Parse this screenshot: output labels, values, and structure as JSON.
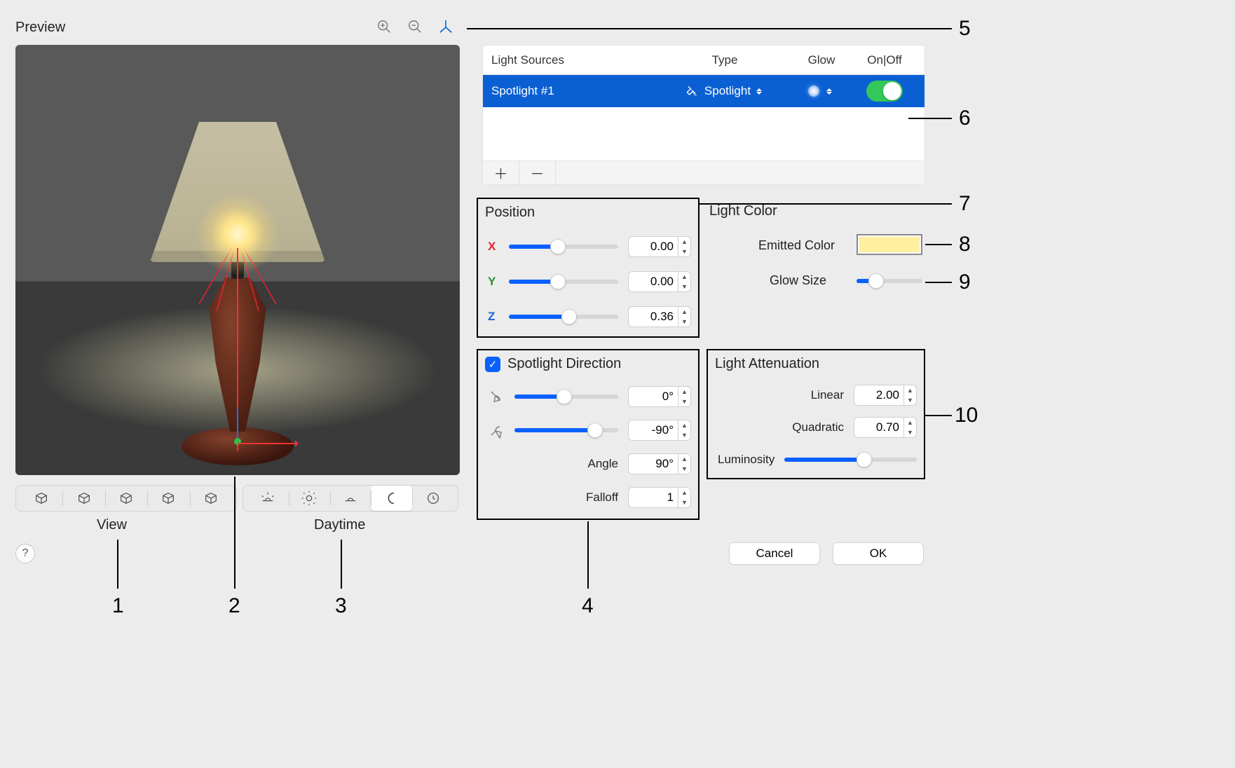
{
  "preview": {
    "title": "Preview"
  },
  "toolbar": {
    "view_label": "View",
    "daytime_label": "Daytime"
  },
  "light_table": {
    "headers": {
      "sources": "Light Sources",
      "type": "Type",
      "glow": "Glow",
      "onoff": "On|Off"
    },
    "rows": [
      {
        "name": "Spotlight #1",
        "type": "Spotlight",
        "glow_icon": "glow-dot",
        "on": true
      }
    ]
  },
  "position": {
    "title": "Position",
    "x": {
      "label": "X",
      "value": "0.00",
      "pct": 45
    },
    "y": {
      "label": "Y",
      "value": "0.00",
      "pct": 45
    },
    "z": {
      "label": "Z",
      "value": "0.36",
      "pct": 55
    }
  },
  "light_color": {
    "title": "Light Color",
    "emitted_label": "Emitted Color",
    "emitted_hex": "#ffef9e",
    "glow_size_label": "Glow Size",
    "glow_size_pct": 30
  },
  "spot_dir": {
    "title": "Spotlight Direction",
    "checked": true,
    "az": {
      "value": "0°",
      "pct": 48
    },
    "el": {
      "value": "-90°",
      "pct": 78
    },
    "angle": {
      "label": "Angle",
      "value": "90°"
    },
    "falloff": {
      "label": "Falloff",
      "value": "1"
    }
  },
  "atten": {
    "title": "Light Attenuation",
    "linear": {
      "label": "Linear",
      "value": "2.00"
    },
    "quadratic": {
      "label": "Quadratic",
      "value": "0.70"
    },
    "luminosity": {
      "label": "Luminosity",
      "pct": 60
    }
  },
  "buttons": {
    "cancel": "Cancel",
    "ok": "OK"
  },
  "callouts": [
    "1",
    "2",
    "3",
    "4",
    "5",
    "6",
    "7",
    "8",
    "9",
    "10"
  ]
}
